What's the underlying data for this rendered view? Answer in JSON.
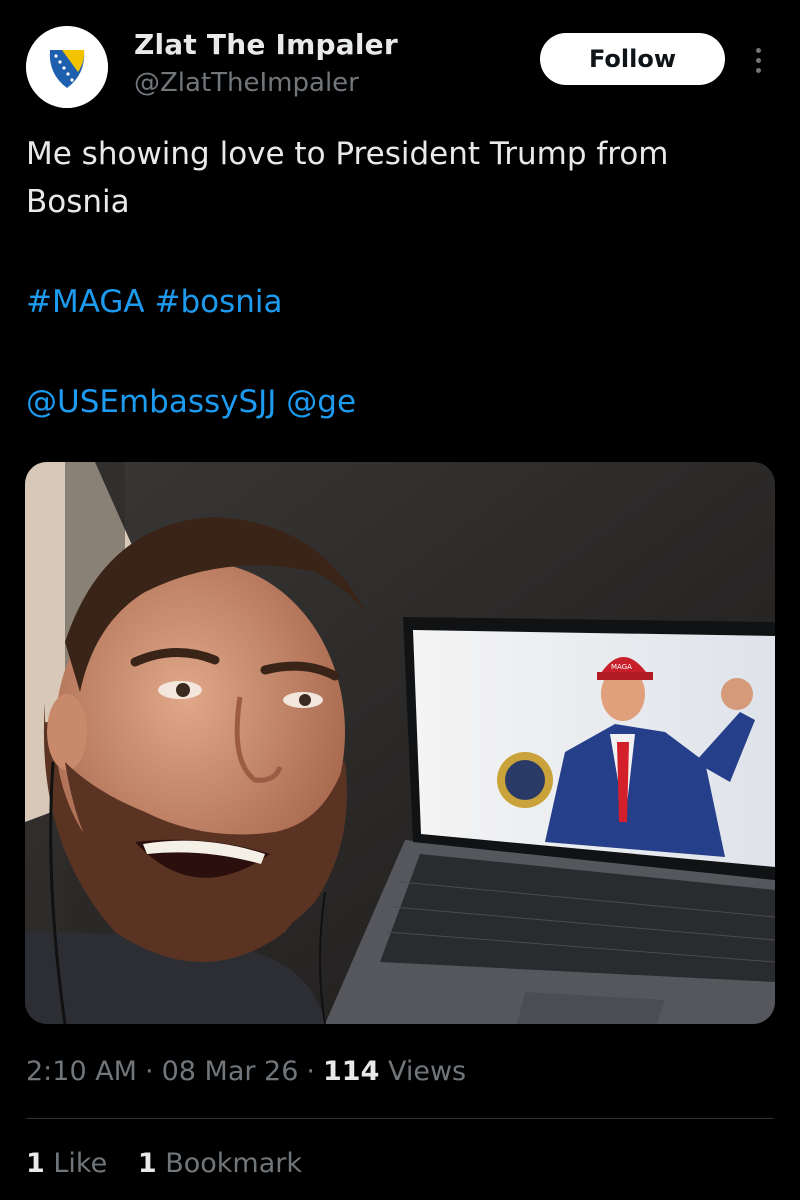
{
  "author": {
    "display_name": "Zlat The Impaler",
    "handle": "@ZlatTheImpaler",
    "avatar_icon": "bosnian-shield-avatar"
  },
  "actions": {
    "follow_label": "Follow",
    "more_icon": "more-vertical-icon"
  },
  "tweet": {
    "text_lines": [
      "Me showing love to President Trump from",
      "Bosnia"
    ],
    "hashtags": [
      "#MAGA",
      "#bosnia"
    ],
    "mentions": [
      "@USEmbassySJJ",
      "@ge"
    ]
  },
  "media": {
    "screen_cap_text": "MAGA"
  },
  "meta": {
    "time": "2:10 AM",
    "separator": "·",
    "date": "08 Mar 26",
    "views_count": "114",
    "views_label": "Views"
  },
  "stats": {
    "likes_count": "1",
    "likes_label": "Like",
    "bookmarks_count": "1",
    "bookmarks_label": "Bookmark"
  },
  "colors": {
    "background": "#000000",
    "text": "#e7e9ea",
    "secondary": "#71767b",
    "link": "#1d9bf0",
    "divider": "#2f3336"
  }
}
